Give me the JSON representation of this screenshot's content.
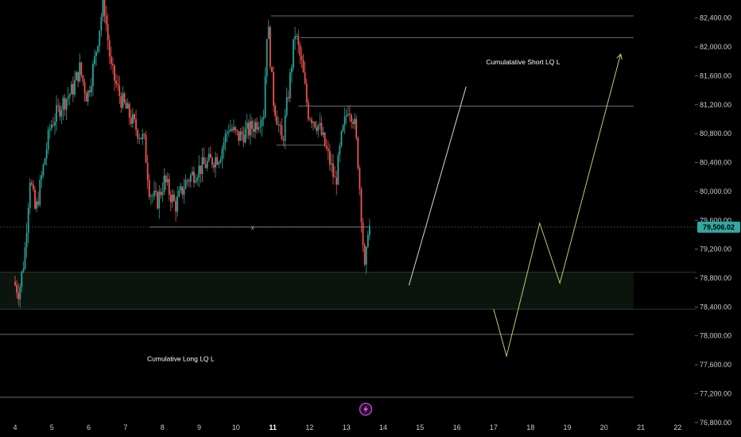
{
  "chart_data": {
    "type": "candlestick",
    "x_axis": {
      "tick_labels": [
        "4",
        "5",
        "6",
        "7",
        "8",
        "9",
        "10",
        "11",
        "12",
        "13",
        "14",
        "15",
        "16",
        "17",
        "18",
        "19",
        "20",
        "21",
        "22"
      ],
      "major_labels": [
        "11"
      ]
    },
    "y_axis": {
      "range": [
        76600,
        82650
      ],
      "tick_values": [
        82400,
        82000,
        81600,
        81200,
        80800,
        80400,
        80000,
        79600,
        79200,
        78800,
        78400,
        78000,
        77600,
        77200,
        76800
      ],
      "tick_labels": [
        "82,400.00",
        "82,000.00",
        "81,600.00",
        "81,200.00",
        "80,800.00",
        "80,400.00",
        "80,000.00",
        "79,600.00",
        "79,200.00",
        "78,800.00",
        "78,400.00",
        "78,000.00",
        "77,600.00",
        "77,200.00",
        "76,800.00"
      ]
    },
    "current_price": {
      "value": 79506.02,
      "label": "79,506.02",
      "color": "#2fa9a1"
    },
    "colors": {
      "up": "#26a69a",
      "down": "#ef5350",
      "background": "#000000",
      "projection": "#c6c96a",
      "zone": "#0b140d"
    },
    "candles_anchor_path": [
      [
        4.0,
        78750
      ],
      [
        4.15,
        78600
      ],
      [
        4.3,
        79100
      ],
      [
        4.45,
        80200
      ],
      [
        4.6,
        79700
      ],
      [
        4.8,
        80300
      ],
      [
        5.0,
        80900
      ],
      [
        5.3,
        81200
      ],
      [
        5.6,
        81400
      ],
      [
        5.8,
        81700
      ],
      [
        6.0,
        81300
      ],
      [
        6.2,
        81800
      ],
      [
        6.45,
        82650
      ],
      [
        6.65,
        81700
      ],
      [
        6.9,
        81300
      ],
      [
        7.1,
        81100
      ],
      [
        7.3,
        80900
      ],
      [
        7.55,
        80700
      ],
      [
        7.7,
        80000
      ],
      [
        7.9,
        79850
      ],
      [
        8.1,
        80150
      ],
      [
        8.4,
        79800
      ],
      [
        8.7,
        80150
      ],
      [
        9.0,
        80300
      ],
      [
        9.3,
        80400
      ],
      [
        9.6,
        80500
      ],
      [
        9.85,
        80900
      ],
      [
        10.1,
        80750
      ],
      [
        10.4,
        80850
      ],
      [
        10.6,
        80950
      ],
      [
        10.8,
        81100
      ],
      [
        10.9,
        82400
      ],
      [
        11.05,
        81300
      ],
      [
        11.3,
        80650
      ],
      [
        11.5,
        81500
      ],
      [
        11.65,
        82200
      ],
      [
        11.85,
        81700
      ],
      [
        12.0,
        81100
      ],
      [
        12.3,
        80900
      ],
      [
        12.6,
        80400
      ],
      [
        12.75,
        80100
      ],
      [
        12.9,
        80700
      ],
      [
        13.1,
        81200
      ],
      [
        13.25,
        81000
      ],
      [
        13.35,
        80500
      ],
      [
        13.45,
        79700
      ],
      [
        13.55,
        78800
      ],
      [
        13.63,
        79506
      ]
    ],
    "levels": [
      {
        "price": 82430,
        "x_from": 10.95,
        "x_to": 20.8
      },
      {
        "price": 82130,
        "x_from": 11.75,
        "x_to": 20.8
      },
      {
        "price": 81180,
        "x_from": 11.7,
        "x_to": 20.8
      },
      {
        "price": 80640,
        "x_from": 11.1,
        "x_to": 12.4
      },
      {
        "price": 79506,
        "x_from": 7.65,
        "x_to": 13.6,
        "marker": "x"
      },
      {
        "price": 78020,
        "x_from": 3.55,
        "x_to": 20.8
      },
      {
        "price": 77150,
        "x_from": 3.55,
        "x_to": 20.8
      }
    ],
    "zone": {
      "price_top": 78880,
      "price_bottom": 78370,
      "x_from": 3.55,
      "x_to": 20.8
    },
    "projections": [
      {
        "points": [
          [
            14.7,
            78700
          ],
          [
            16.25,
            81450
          ]
        ],
        "arrow": false
      },
      {
        "points": [
          [
            17.0,
            78370
          ],
          [
            17.35,
            77720
          ],
          [
            18.25,
            79560
          ],
          [
            18.8,
            78730
          ],
          [
            20.45,
            81900
          ]
        ],
        "arrow": true
      }
    ],
    "annotations": [
      {
        "text": "Cumulatative Short LQ L",
        "x": 17.8,
        "price": 81760
      },
      {
        "text": "Cumulative Long LQ L",
        "x": 8.5,
        "price": 77650
      }
    ]
  }
}
